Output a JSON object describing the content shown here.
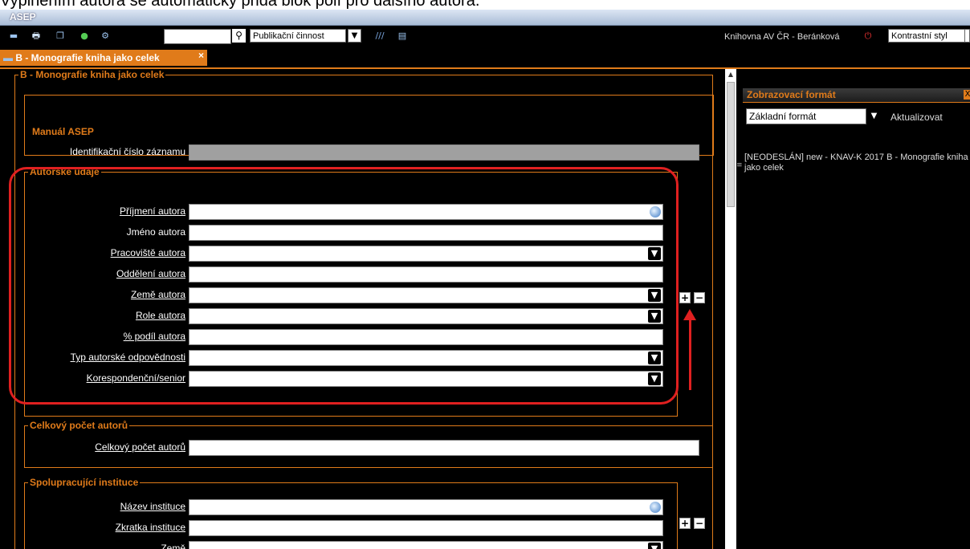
{
  "doc_line": "Vyplněním autora se automaticky přidá blok polí pro dalšího autora.",
  "app": {
    "title": "ASEP"
  },
  "toolbar": {
    "search_value": "",
    "category_select": "Publikační činnost",
    "library_user": "Knihovna AV ČR - Beránková",
    "style_select": "Kontrastní styl"
  },
  "tabs": [
    {
      "label": "B - Monografie kniha jako celek",
      "close": "×"
    }
  ],
  "form": {
    "main_legend": "B - Monografie kniha jako celek",
    "manual": {
      "heading": "Manuál ASEP",
      "id_label": "Identifikační číslo záznamu",
      "id_value": ""
    },
    "authors": {
      "legend": "Autorské údaje",
      "fields": [
        {
          "label": "Příjmení autora",
          "value": ""
        },
        {
          "label": "Jméno autora",
          "value": ""
        },
        {
          "label": "Pracoviště autora",
          "value": ""
        },
        {
          "label": "Oddělení autora",
          "value": ""
        },
        {
          "label": "Země autora",
          "value": ""
        },
        {
          "label": "Role autora",
          "value": ""
        },
        {
          "label": "% podíl autora",
          "value": ""
        },
        {
          "label": "Typ autorské odpovědnosti",
          "value": ""
        },
        {
          "label": "Korespondenční/senior",
          "value": ""
        }
      ],
      "add": "+",
      "remove": "−"
    },
    "total_authors": {
      "legend": "Celkový počet autorů",
      "label": "Celkový počet autorů",
      "value": ""
    },
    "institutions": {
      "legend": "Spolupracující instituce",
      "fields": [
        {
          "label": "Název instituce",
          "value": ""
        },
        {
          "label": "Zkratka instituce",
          "value": ""
        },
        {
          "label": "Země",
          "value": ""
        }
      ],
      "add": "+",
      "remove": "−"
    }
  },
  "sidebar": {
    "title": "Zobrazovací formát",
    "close": "X",
    "format_select": "Základní formát",
    "refresh": "Aktualizovat",
    "record_text": "[NEODESLÁN] new - KNAV-K 2017 B - Monografie kniha jako celek"
  },
  "colors": {
    "accent": "#e07b1a",
    "highlight": "#e02020",
    "background": "#000000"
  },
  "icons": [
    "list-icon",
    "print-icon",
    "copy-icon",
    "check-icon",
    "settings-icon",
    "search-icon",
    "dropdown-icon",
    "stripes-icon",
    "save-icon",
    "power-icon",
    "lookup-icon",
    "plus-icon",
    "minus-icon"
  ]
}
